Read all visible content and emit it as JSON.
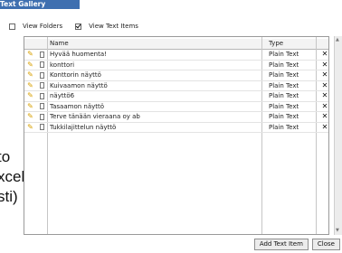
{
  "window": {
    "title": "Text Gallery"
  },
  "options": {
    "view_folders": "View Folders",
    "view_text_items": "View Text Items"
  },
  "table": {
    "headers": {
      "name": "Name",
      "type": "Type"
    },
    "rows": [
      {
        "name": "Hyvää huomenta!",
        "type": "Plain Text"
      },
      {
        "name": "konttori",
        "type": "Plain Text"
      },
      {
        "name": "Konttorin näyttö",
        "type": "Plain Text"
      },
      {
        "name": "Kuivaamon näyttö",
        "type": "Plain Text"
      },
      {
        "name": "näyttö6",
        "type": "Plain Text"
      },
      {
        "name": "Tasaamon näyttö",
        "type": "Plain Text"
      },
      {
        "name": "Terve tänään vieraana oy ab",
        "type": "Plain Text"
      },
      {
        "name": "Tukkilajittelun näyttö",
        "type": "Plain Text"
      }
    ],
    "delete_glyph": "✕"
  },
  "buttons": {
    "add_text_item": "Add Text Item",
    "close": "Close"
  },
  "background_text": [
    "to",
    "xcel",
    "sti)"
  ]
}
